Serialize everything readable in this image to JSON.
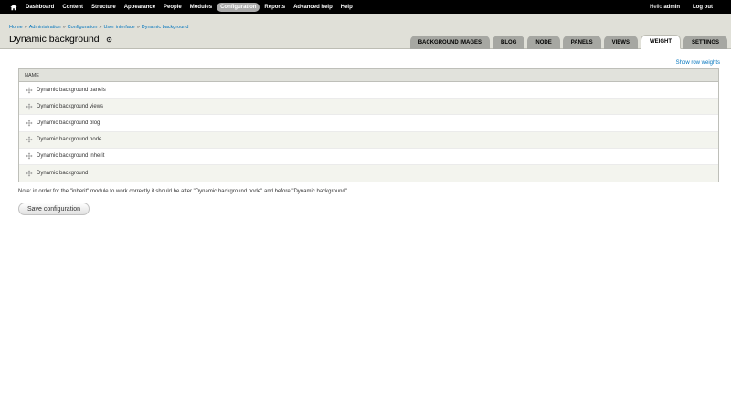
{
  "toolbar": {
    "home_icon": "home-icon",
    "items": [
      {
        "label": "Dashboard",
        "active": false
      },
      {
        "label": "Content",
        "active": false
      },
      {
        "label": "Structure",
        "active": false
      },
      {
        "label": "Appearance",
        "active": false
      },
      {
        "label": "People",
        "active": false
      },
      {
        "label": "Modules",
        "active": false
      },
      {
        "label": "Configuration",
        "active": true
      },
      {
        "label": "Reports",
        "active": false
      },
      {
        "label": "Advanced help",
        "active": false
      },
      {
        "label": "Help",
        "active": false
      }
    ],
    "hello_prefix": "Hello ",
    "username": "admin",
    "logout": "Log out"
  },
  "breadcrumb": [
    "Home",
    "Administration",
    "Configuration",
    "User interface",
    "Dynamic background"
  ],
  "breadcrumb_separator": "»",
  "page_title": "Dynamic background",
  "tabs": [
    {
      "label": "Background images",
      "active": false
    },
    {
      "label": "Blog",
      "active": false
    },
    {
      "label": "Node",
      "active": false
    },
    {
      "label": "Panels",
      "active": false
    },
    {
      "label": "Views",
      "active": false
    },
    {
      "label": "Weight",
      "active": true
    },
    {
      "label": "Settings",
      "active": false
    }
  ],
  "show_row_weights": "Show row weights",
  "table": {
    "header": "Name",
    "rows": [
      "Dynamic background panels",
      "Dynamic background views",
      "Dynamic background blog",
      "Dynamic background node",
      "Dynamic background inherit",
      "Dynamic background"
    ]
  },
  "note": "Note: in order for the \"inherit\" module to work correctly it should be after \"Dynamic background node\" and before \"Dynamic background\".",
  "save_button": "Save configuration",
  "colors": {
    "toolbar_bg": "#000000",
    "header_bg": "#e0e0d8",
    "link": "#0074bd",
    "tab_bg": "#a6a7a2",
    "row_alt": "#f3f4ee"
  }
}
